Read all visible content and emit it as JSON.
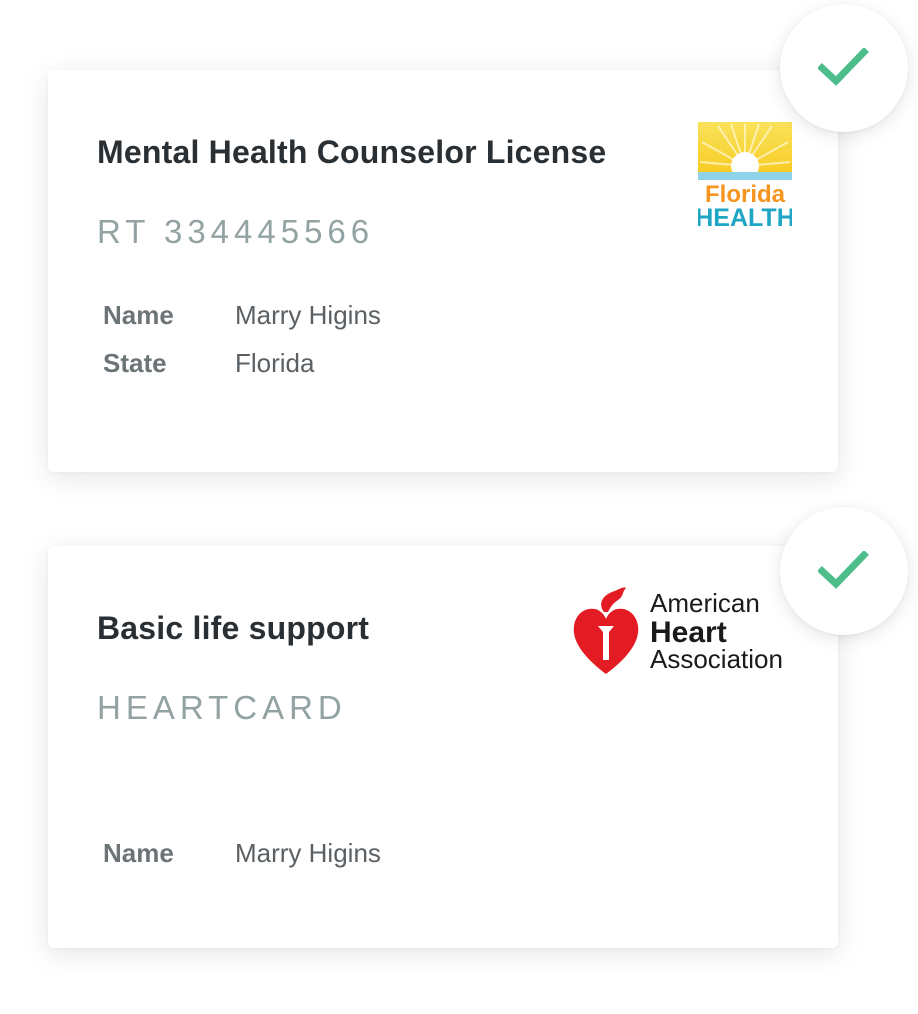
{
  "cards": [
    {
      "title": "Mental Health Counselor License",
      "code": "RT 334445566",
      "logo": {
        "name": "florida-health-logo",
        "line1": "Florida",
        "line2": "HEALTH"
      },
      "fields": [
        {
          "label": "Name",
          "value": "Marry Higins"
        },
        {
          "label": "State",
          "value": "Florida"
        }
      ],
      "verified": true
    },
    {
      "title": "Basic life support",
      "code": "HEARTCARD",
      "logo": {
        "name": "american-heart-association-logo",
        "line1": "American",
        "line2": "Heart",
        "line3": "Association"
      },
      "fields": [
        {
          "label": "Name",
          "value": "Marry Higins"
        }
      ],
      "verified": true
    }
  ],
  "colors": {
    "check": "#4ebd8c",
    "code_text": "#93a3a3",
    "title_text": "#2a2f33",
    "aha_red": "#e31b23",
    "florida_yellow": "#f7c71a",
    "florida_orange": "#f7941d",
    "florida_teal": "#1ea6c4"
  },
  "icons": {
    "badge": "checkmark-icon"
  }
}
